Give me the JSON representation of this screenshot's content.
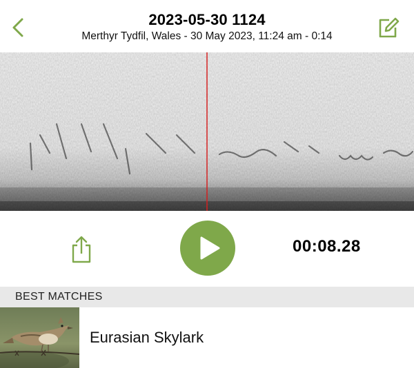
{
  "header": {
    "title": "2023-05-30 1124",
    "subtitle": "Merthyr Tydfil, Wales - 30 May 2023, 11:24 am - 0:14"
  },
  "playback": {
    "elapsed": "00:08.28"
  },
  "matches": {
    "section_label": "BEST MATCHES",
    "items": [
      {
        "name": "Eurasian Skylark"
      }
    ]
  },
  "colors": {
    "accent": "#7fa84a",
    "playhead": "#d42020",
    "section_bg": "#e8e8e8"
  },
  "icons": {
    "back": "chevron-left-icon",
    "edit": "edit-icon",
    "share": "share-icon",
    "play": "play-icon"
  }
}
